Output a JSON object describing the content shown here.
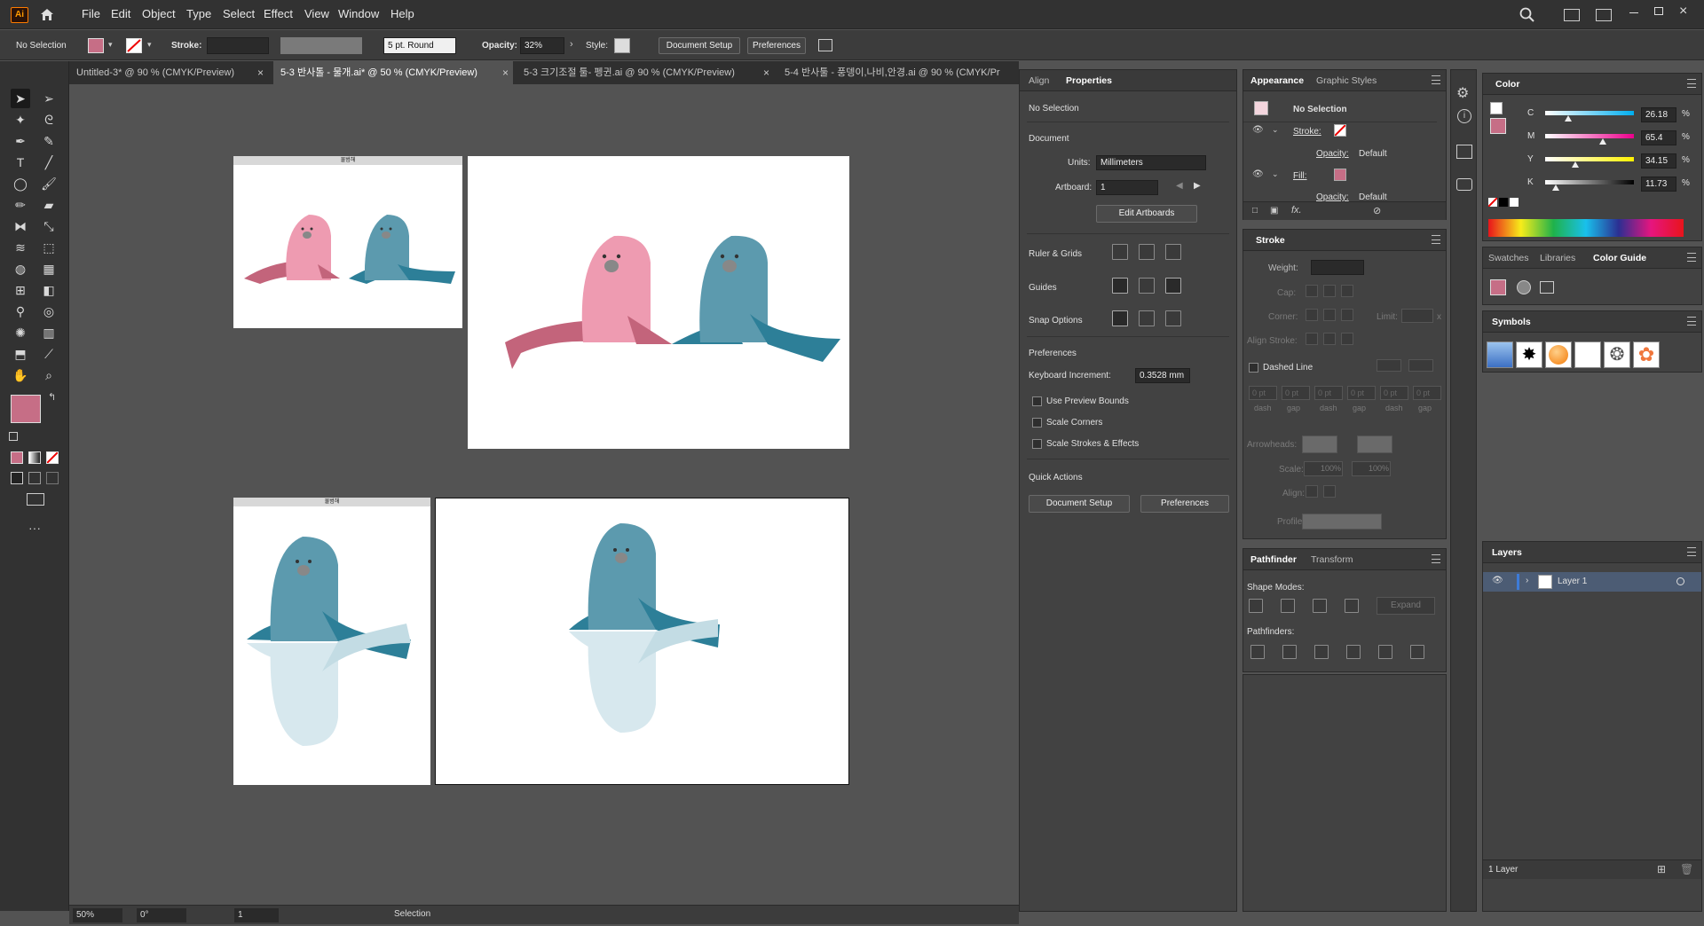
{
  "app": {
    "logo": "Ai"
  },
  "menu": [
    "File",
    "Edit",
    "Object",
    "Type",
    "Select",
    "Effect",
    "View",
    "Window",
    "Help"
  ],
  "control_bar": {
    "selection": "No Selection",
    "stroke_label": "Stroke:",
    "brush": "5 pt. Round",
    "opacity_label": "Opacity:",
    "opacity_value": "32%",
    "style_label": "Style:",
    "document_setup": "Document Setup",
    "preferences": "Preferences"
  },
  "tabs": [
    {
      "label": "Untitled-3* @ 90 % (CMYK/Preview)"
    },
    {
      "label": "5-3 반사톨 - 물개.ai* @ 50 % (CMYK/Preview)"
    },
    {
      "label": "5-3 크기조절 툴- 펭귄.ai @ 90 % (CMYK/Preview)"
    },
    {
      "label": "5-4 반사툴 - 풍뎅이,나비,안경.ai @ 90 % (CMYK/Pr"
    }
  ],
  "tab_close": "×",
  "artboards": {
    "title_text": "물범해"
  },
  "status_bar": {
    "zoom": "50%",
    "rotation": "0°",
    "artboard": "1",
    "tool": "Selection"
  },
  "properties_panel": {
    "tabs": [
      "Align",
      "Properties"
    ],
    "no_selection": "No Selection",
    "document": "Document",
    "units_label": "Units:",
    "units_value": "Millimeters",
    "artboard_label": "Artboard:",
    "artboard_value": "1",
    "edit_artboards": "Edit Artboards",
    "ruler_grids": "Ruler & Grids",
    "guides": "Guides",
    "snap_options": "Snap Options",
    "preferences_heading": "Preferences",
    "keyboard_increment_label": "Keyboard Increment:",
    "keyboard_increment_value": "0.3528 mm",
    "use_preview_bounds": "Use Preview Bounds",
    "scale_corners": "Scale Corners",
    "scale_strokes": "Scale Strokes & Effects",
    "quick_actions": "Quick Actions",
    "qa_document_setup": "Document Setup",
    "qa_preferences": "Preferences"
  },
  "appearance_panel": {
    "tabs": [
      "Appearance",
      "Graphic Styles"
    ],
    "no_selection": "No Selection",
    "stroke": "Stroke:",
    "opacity": "Opacity:",
    "default": "Default",
    "fill": "Fill:",
    "fx": "fx."
  },
  "stroke_panel": {
    "title": "Stroke",
    "weight": "Weight:",
    "cap": "Cap:",
    "corner": "Corner:",
    "limit": "Limit:",
    "limit_x": "x",
    "align_stroke": "Align Stroke:",
    "dashed_line": "Dashed Line",
    "dash_values": [
      "0 pt",
      "0 pt",
      "0 pt",
      "0 pt",
      "0 pt",
      "0 pt"
    ],
    "dash_labels": [
      "dash",
      "gap",
      "dash",
      "gap",
      "dash",
      "gap"
    ],
    "arrowheads": "Arrowheads:",
    "scale": "Scale:",
    "scale_values": [
      "100%",
      "100%"
    ],
    "align": "Align:",
    "profile": "Profile:"
  },
  "pathfinder_panel": {
    "tabs": [
      "Pathfinder",
      "Transform"
    ],
    "shape_modes": "Shape Modes:",
    "expand": "Expand",
    "pathfinders": "Pathfinders:"
  },
  "color_panel": {
    "title": "Color",
    "channels": [
      {
        "name": "C",
        "value": "26.18",
        "unit": "%",
        "level": 0.2618
      },
      {
        "name": "M",
        "value": "65.4",
        "unit": "%",
        "level": 0.654
      },
      {
        "name": "Y",
        "value": "34.15",
        "unit": "%",
        "level": 0.3415
      },
      {
        "name": "K",
        "value": "11.73",
        "unit": "%",
        "level": 0.1173
      }
    ]
  },
  "swatch_panel": {
    "tabs": [
      "Swatches",
      "Libraries",
      "Color Guide"
    ]
  },
  "symbols_panel": {
    "title": "Symbols"
  },
  "layers_panel": {
    "title": "Layers",
    "layer_name": "Layer 1",
    "footer": "1 Layer"
  },
  "colors": {
    "fill": "#c66e86",
    "pink_seal": "#ee9bb1",
    "pink_dark": "#c3647b",
    "teal_seal": "#5c9aae",
    "teal_dark": "#2d7f98",
    "teal_reflect": "#d7e8ee",
    "layer_accent": "#3d7bd8"
  }
}
